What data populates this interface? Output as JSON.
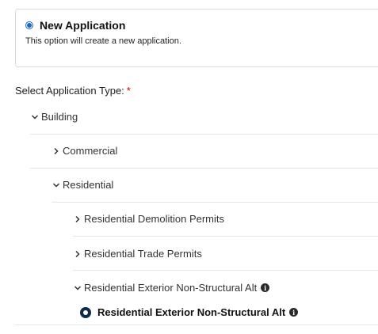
{
  "option": {
    "title": "New Application",
    "description": "This option will create a new application."
  },
  "select": {
    "label": "Select Application Type:",
    "required_marker": "*"
  },
  "tree": {
    "building": "Building",
    "commercial": "Commercial",
    "residential": "Residential",
    "res_demolition": "Residential Demolition Permits",
    "res_trade": "Residential Trade Permits",
    "res_exterior_group": "Residential Exterior Non-Structural Alt",
    "res_exterior_option": "Residential Exterior Non-Structural Alt"
  },
  "colors": {
    "accent": "#1a66c2",
    "selected_radio": "#0f2a4a",
    "required": "#cc0000"
  }
}
